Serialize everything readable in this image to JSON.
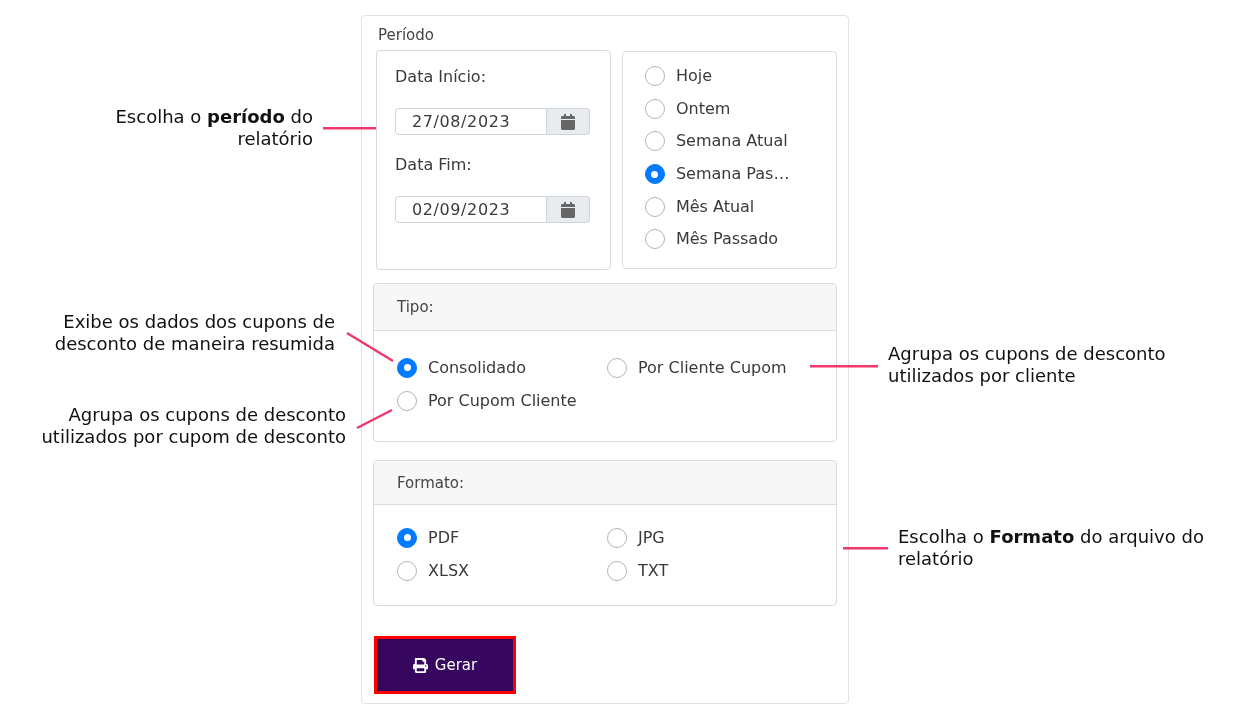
{
  "form": {
    "period": {
      "title": "Período",
      "dates": [
        {
          "label": "Data Início:",
          "value": "27/08/2023"
        },
        {
          "label": "Data Fim:",
          "value": "02/09/2023"
        }
      ],
      "presets": [
        {
          "label": "Hoje",
          "selected": false
        },
        {
          "label": "Ontem",
          "selected": false
        },
        {
          "label": "Semana Atual",
          "selected": false
        },
        {
          "label": "Semana Pas…",
          "selected": true
        },
        {
          "label": "Mês Atual",
          "selected": false
        },
        {
          "label": "Mês Passado",
          "selected": false
        }
      ]
    },
    "type": {
      "title": "Tipo:",
      "options": [
        {
          "label": "Consolidado",
          "selected": true
        },
        {
          "label": "Por Cliente Cupom",
          "selected": false
        },
        {
          "label": "Por Cupom Cliente",
          "selected": false
        }
      ]
    },
    "format": {
      "title": "Formato:",
      "options": [
        {
          "label": "PDF",
          "selected": true
        },
        {
          "label": "JPG",
          "selected": false
        },
        {
          "label": "XLSX",
          "selected": false
        },
        {
          "label": "TXT",
          "selected": false
        }
      ]
    },
    "generate_button": {
      "label": "Gerar",
      "highlighted": true
    }
  },
  "annotations": [
    {
      "lines": [
        "Escolha o **período** do",
        "relatório"
      ]
    },
    {
      "lines": [
        "Exibe os dados dos cupons de",
        "desconto de maneira resumida"
      ]
    },
    {
      "lines": [
        "Agrupa os cupons de desconto",
        "utilizados por cupom de desconto"
      ]
    },
    {
      "lines": [
        "Agrupa os cupons de desconto",
        "utilizados por cliente"
      ]
    },
    {
      "lines": [
        "Escolha o **Formato** do arquivo do",
        "relatório"
      ]
    }
  ]
}
